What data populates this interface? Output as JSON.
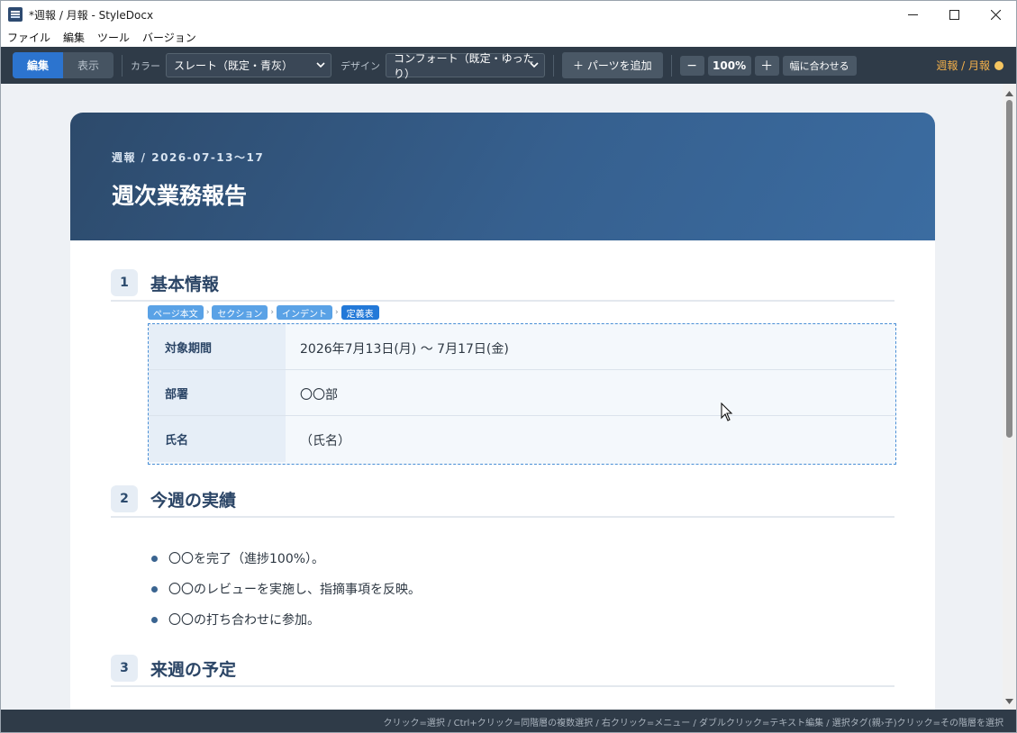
{
  "window": {
    "title": "*週報 / 月報 - StyleDocx",
    "controls": [
      "minimize-icon",
      "maximize-icon",
      "close-icon"
    ]
  },
  "menu": [
    "ファイル",
    "編集",
    "ツール",
    "バージョン"
  ],
  "toolbar": {
    "modes": [
      {
        "label": "編集",
        "active": true
      },
      {
        "label": "表示",
        "active": false
      }
    ],
    "color_label": "カラー",
    "color_value": "スレート（既定・青灰）",
    "design_label": "デザイン",
    "design_value": "コンフォート（既定・ゆったり）",
    "add_parts_label": "＋ パーツを追加",
    "zoom_out": "−",
    "zoom_value": "100%",
    "zoom_in": "＋",
    "fit_width_label": "幅に合わせる",
    "doc_kind": "週報 / 月報",
    "doc_kind_color": "#f5b14a"
  },
  "document": {
    "header_sub": "週報 / 2026-07-13〜17",
    "header_title": "週次業務報告",
    "sections": [
      {
        "num": "1",
        "title": "基本情報"
      },
      {
        "num": "2",
        "title": "今週の実績"
      },
      {
        "num": "3",
        "title": "来週の予定"
      }
    ],
    "selection_tags": [
      "ページ本文",
      "セクション",
      "インデント",
      "定義表"
    ],
    "definitions": [
      {
        "key": "対象期間",
        "value": "2026年7月13日(月) 〜 7月17日(金)"
      },
      {
        "key": "部署",
        "value": "〇〇部"
      },
      {
        "key": "氏名",
        "value": "（氏名）"
      }
    ],
    "bullets": [
      "〇〇を完了（進捗100%）。",
      "〇〇のレビューを実施し、指摘事項を反映。",
      "〇〇の打ち合わせに参加。"
    ]
  },
  "statusbar": {
    "hint": "クリック=選択 / Ctrl+クリック=同階層の複数選択 / 右クリック=メニュー / ダブルクリック=テキスト編集 / 選択タグ(親›子)クリック=その階層を選択"
  },
  "colors": {
    "toolbar_bg": "#2f3b48",
    "accent": "#2c74cf",
    "header_gradient_start": "#2d4a6b",
    "header_gradient_end": "#3b6ca1",
    "heading_text": "#2b4566"
  }
}
